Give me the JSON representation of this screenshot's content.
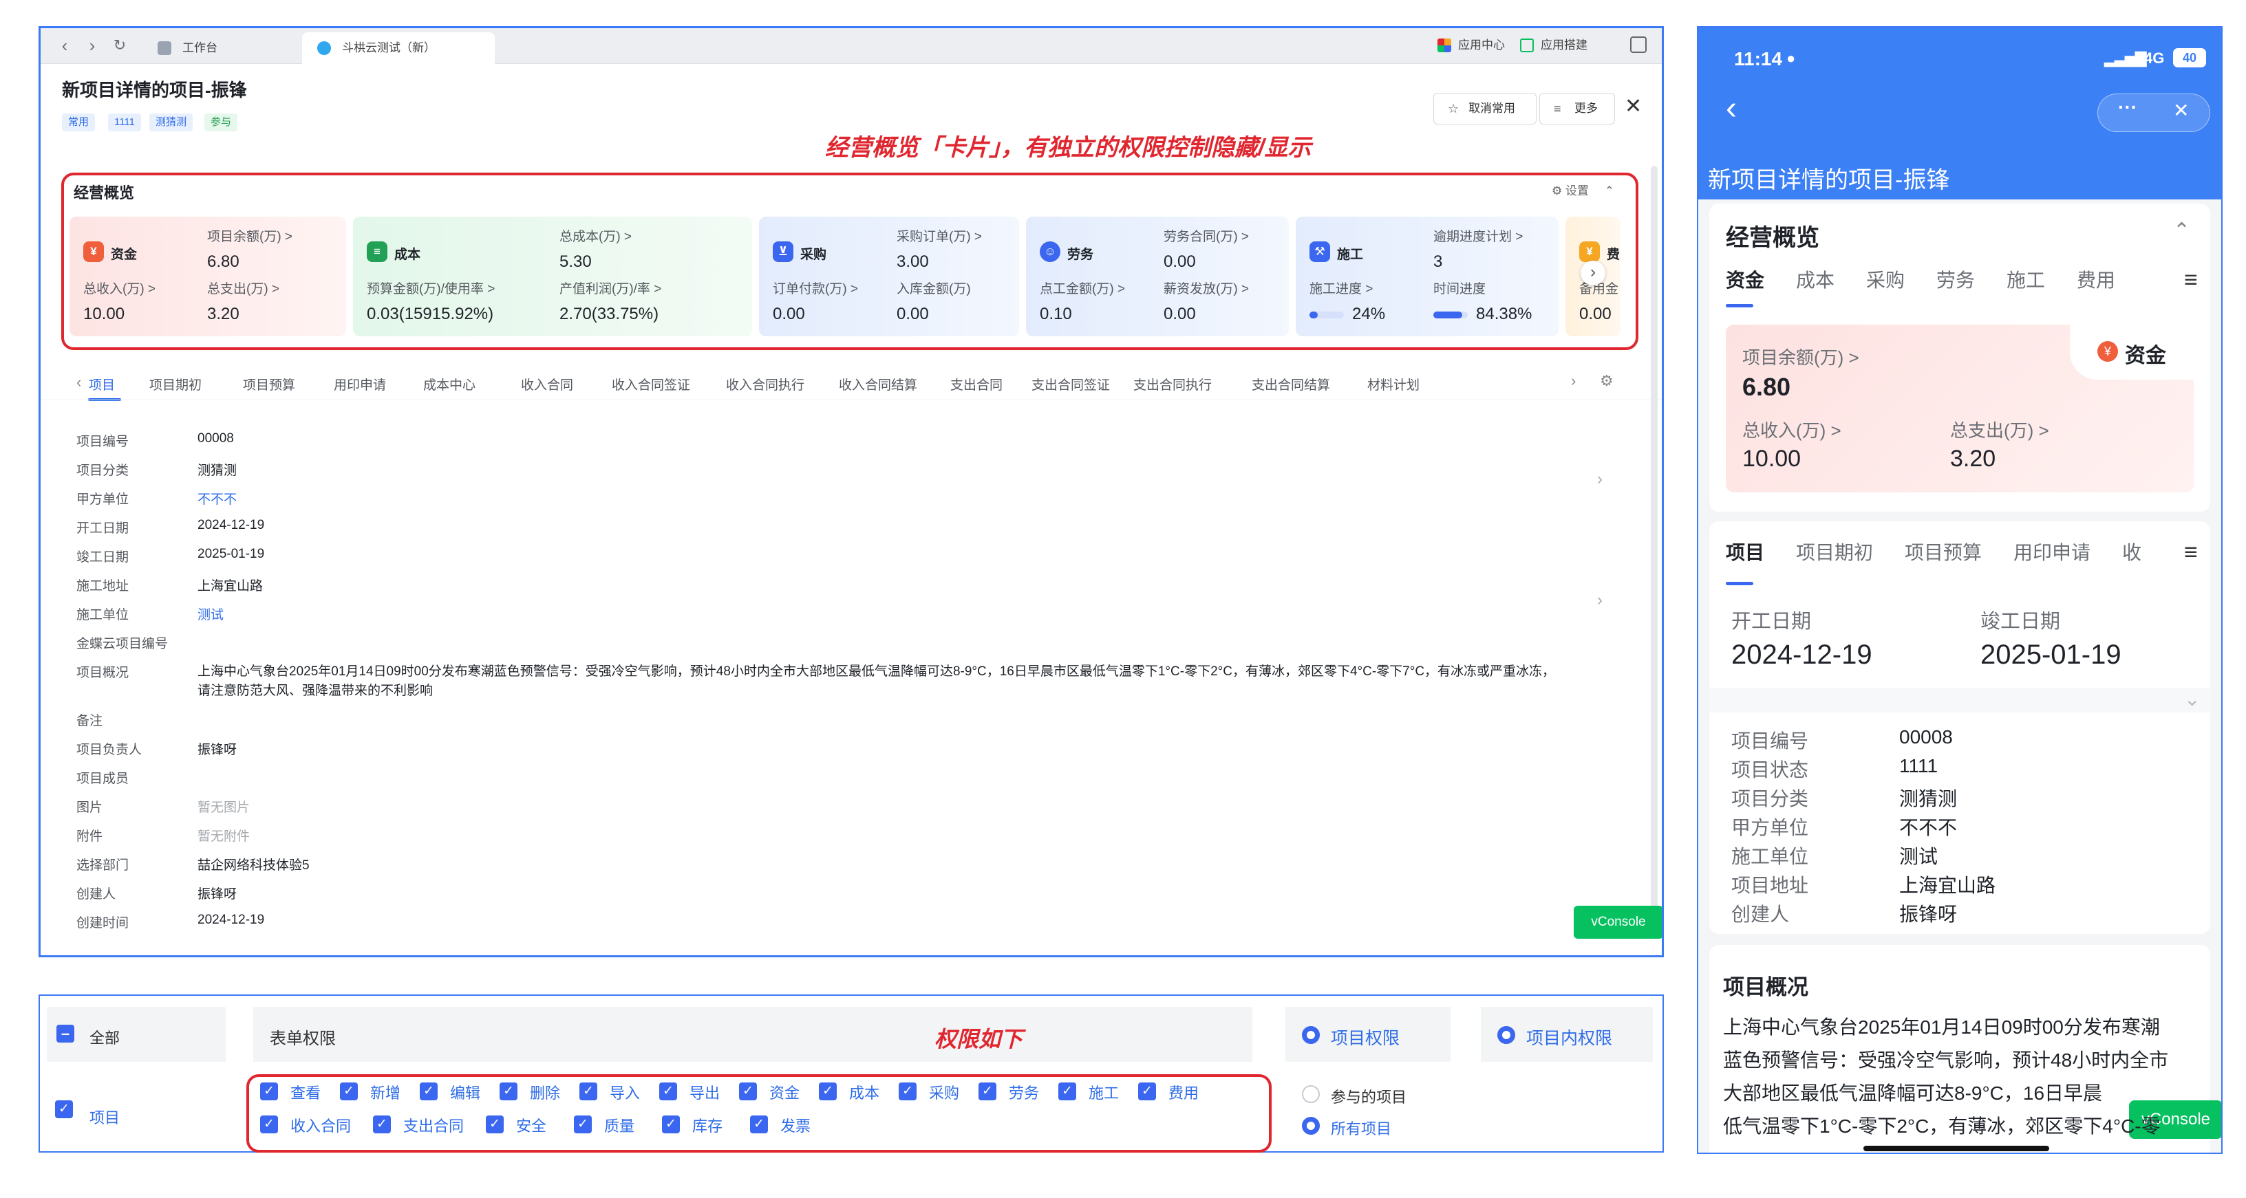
{
  "browser": {
    "tabs": [
      {
        "label": "工作台"
      },
      {
        "label": "斗栱云测试（新）"
      }
    ],
    "right": [
      {
        "label": "应用中心"
      },
      {
        "label": "应用搭建"
      }
    ]
  },
  "page": {
    "title": "新项目详情的项目-振锋",
    "tags": [
      "常用",
      "1111",
      "测猜测",
      "参与"
    ],
    "actions": {
      "unfavorite": "取消常用",
      "more": "更多"
    }
  },
  "annotations": {
    "card_note": "经营概览「卡片」，有独立的权限控制隐藏/显示",
    "perm_note": "权限如下"
  },
  "overview": {
    "title": "经营概览",
    "settings": "设置",
    "cards": [
      {
        "name": "资金",
        "fields": [
          {
            "label": "项目余额(万) >",
            "value": "6.80"
          },
          {
            "label": "总收入(万) >",
            "value": "10.00"
          },
          {
            "label": "总支出(万) >",
            "value": "3.20"
          }
        ]
      },
      {
        "name": "成本",
        "fields": [
          {
            "label": "总成本(万) >",
            "value": "5.30"
          },
          {
            "label": "预算金额(万)/使用率 >",
            "value": "0.03(15915.92%)"
          },
          {
            "label": "产值利润(万)/率 >",
            "value": "2.70(33.75%)"
          }
        ]
      },
      {
        "name": "采购",
        "fields": [
          {
            "label": "采购订单(万) >",
            "value": "3.00"
          },
          {
            "label": "订单付款(万) >",
            "value": "0.00"
          },
          {
            "label": "入库金额(万)",
            "value": "0.00"
          }
        ]
      },
      {
        "name": "劳务",
        "fields": [
          {
            "label": "劳务合同(万) >",
            "value": "0.00"
          },
          {
            "label": "点工金额(万) >",
            "value": "0.10"
          },
          {
            "label": "薪资发放(万) >",
            "value": "0.00"
          }
        ]
      },
      {
        "name": "施工",
        "fields": [
          {
            "label": "逾期进度计划 >",
            "value": "3"
          },
          {
            "label": "施工进度 >",
            "value": "24%",
            "progress": 0.24
          },
          {
            "label": "时间进度",
            "value": "84.38%",
            "progress": 0.8438
          }
        ]
      },
      {
        "name": "费",
        "fields": [
          {
            "label": "备用金",
            "value": "0.00"
          }
        ]
      }
    ]
  },
  "project_tabs": [
    "项目",
    "项目期初",
    "项目预算",
    "用印申请",
    "成本中心",
    "收入合同",
    "收入合同签证",
    "收入合同执行",
    "收入合同结算",
    "支出合同",
    "支出合同签证",
    "支出合同执行",
    "支出合同结算",
    "材料计划"
  ],
  "details": [
    {
      "label": "项目编号",
      "value": "00008"
    },
    {
      "label": "项目分类",
      "value": "测猜测"
    },
    {
      "label": "甲方单位",
      "value": "不不不"
    },
    {
      "label": "开工日期",
      "value": "2024-12-19"
    },
    {
      "label": "竣工日期",
      "value": "2025-01-19"
    },
    {
      "label": "施工地址",
      "value": "上海宜山路"
    },
    {
      "label": "施工单位",
      "value": "测试"
    },
    {
      "label": "金蝶云项目编号",
      "value": ""
    },
    {
      "label": "项目概况",
      "value": "上海中心气象台2025年01月14日09时00分发布寒潮蓝色预警信号：受强冷空气影响，预计48小时内全市大部地区最低气温降幅可达8-9°C，16日早晨市区最低气温零下1°C-零下2°C，有薄冰，郊区零下4°C-零下7°C，有冰冻或严重冰冻，请注意防范大风、强降温带来的不利影响"
    },
    {
      "label": "备注",
      "value": ""
    },
    {
      "label": "项目负责人",
      "value": "振锋呀"
    },
    {
      "label": "项目成员",
      "value": ""
    },
    {
      "label": "图片",
      "value": "暂无图片"
    },
    {
      "label": "附件",
      "value": "暂无附件"
    },
    {
      "label": "选择部门",
      "value": "喆企网络科技体验5"
    },
    {
      "label": "创建人",
      "value": "振锋呀"
    },
    {
      "label": "创建时间",
      "value": "2024-12-19"
    }
  ],
  "vconsole": "vConsole",
  "permissions": {
    "all_label": "全部",
    "project_label": "项目",
    "form_title": "表单权限",
    "row1": [
      "查看",
      "新增",
      "编辑",
      "删除",
      "导入",
      "导出",
      "资金",
      "成本",
      "采购",
      "劳务",
      "施工",
      "费用"
    ],
    "row2": [
      "收入合同",
      "支出合同",
      "安全",
      "质量",
      "库存",
      "发票"
    ],
    "scope_project": "项目权限",
    "scope_inner": "项目内权限",
    "options": [
      "参与的项目",
      "所有项目"
    ]
  },
  "mobile": {
    "time": "11:14",
    "network": "4G",
    "battery": "40",
    "more": "···",
    "title": "新项目详情的项目-振锋",
    "overview_title": "经营概览",
    "tabs": [
      "资金",
      "成本",
      "采购",
      "劳务",
      "施工",
      "费用"
    ],
    "fund_card": {
      "name": "资金",
      "balance_label": "项目余额(万) >",
      "balance": "6.80",
      "income_label": "总收入(万) >",
      "income": "10.00",
      "expense_label": "总支出(万) >",
      "expense": "3.20"
    },
    "project_tabs": [
      "项目",
      "项目期初",
      "项目预算",
      "用印申请",
      "收"
    ],
    "start_label": "开工日期",
    "start": "2024-12-19",
    "end_label": "竣工日期",
    "end": "2025-01-19",
    "fields": [
      {
        "label": "项目编号",
        "value": "00008"
      },
      {
        "label": "项目状态",
        "value": "1111"
      },
      {
        "label": "项目分类",
        "value": "测猜测"
      },
      {
        "label": "甲方单位",
        "value": "不不不"
      },
      {
        "label": "施工单位",
        "value": "测试"
      },
      {
        "label": "项目地址",
        "value": "上海宜山路"
      },
      {
        "label": "创建人",
        "value": "振锋呀"
      }
    ],
    "overview_heading": "项目概况",
    "overview_lines": [
      "上海中心气象台2025年01月14日09时00分发布寒潮",
      "蓝色预警信号：受强冷空气影响，预计48小时内全市",
      "大部地区最低气温降幅可达8-9°C，16日早晨",
      "低气温零下1°C-零下2°C，有薄冰，郊区零下4°C-零"
    ]
  },
  "colors": {
    "accent": "#3b66ef",
    "annotation": "#e0262f",
    "vconsole": "#07c160"
  }
}
